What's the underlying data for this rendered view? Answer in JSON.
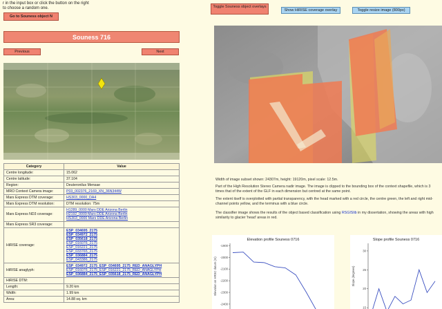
{
  "intro": {
    "line1": "r in the input box or click the button on the right",
    "line2": "to choose a random one."
  },
  "goto_button": "Go to Souness object N",
  "object_title": "Souness 716",
  "nav": {
    "previous": "Previous",
    "next": "Next"
  },
  "top_buttons": {
    "toggle_overlays": "Toggle Souness object overlays",
    "show_hirise": "Show HiRISE coverage overlay",
    "toggle_resize": "Toggle resize image (800px)"
  },
  "table": {
    "header_category": "Category",
    "header_value": "Value",
    "rows": {
      "centre_lon": {
        "k": "Centre longitude:",
        "v": "15.062"
      },
      "centre_lat": {
        "k": "Centre latitude:",
        "v": "37.104"
      },
      "region": {
        "k": "Region:",
        "v": "Deuteronilus Mensae"
      },
      "mro_ctx": {
        "k": "MRO Context Camera image:",
        "v": "P03_002376_2169_XN_36N344W"
      },
      "hirise_dtm_cov": {
        "k": "Mars Express DTM coverage:",
        "v": "HS303_0000_DA4"
      },
      "dtm_res": {
        "k": "Mars Express DTM resolution:",
        "v": "DTM resolution: 75m"
      },
      "nd3": {
        "k": "Mars Express ND3 coverage:",
        "links": [
          "H1289_0000 Mars DDE Arizona Berlin",
          "H2192_0009 Mars DDE Arizona Berlin",
          "HS303_0000 Mars DDE Arizona Berlin"
        ]
      },
      "sr3": {
        "k": "Mars Express SR3 coverage:",
        "v": ""
      },
      "hirise_cov": {
        "k": "HiRISE coverage:",
        "links": [
          "ESP_034695_2175",
          "ESP_034972_2175",
          "ESP_035618_2175",
          "ESP_016076_2175",
          "ESP_016221_2175",
          "ESP_033765_2175",
          "ESP_036884_2175",
          "ESP_043386_2175"
        ]
      },
      "hirise_ana": {
        "k": "HiRISE anaglyph:",
        "links": [
          "ESP_034972_2175_ESP_034695_2175_RED_ANAGLYPH",
          "ESP_016076_2175_ESP_016221_2175_RED_ANAGLYPH",
          "ESP_036884_2175_ESP_035618_2175_RED_ANAGLYPH"
        ]
      },
      "hirise_dtm": {
        "k": "HiRISE DTM:",
        "v": ""
      },
      "length": {
        "k": "Length:",
        "v": "9.20 km"
      },
      "width": {
        "k": "Width:",
        "v": "1.99 km"
      },
      "area": {
        "k": "Area:",
        "v": "14.88 sq. km"
      }
    }
  },
  "image_caption": "Width of image subset shown: 24307m, height: 19120m, pixel scale: 12.5m.",
  "para1": "Part of the High Resolution Stereo Camera nadir image. The image is clipped to the bounding box of the context shapefile, which is 3 times that of the extent of the GLF in each dimension but centred at the same point.",
  "para2": "The extent itself is overplotted with partial transparency, with the head marked with a red circle, the centre green, the left and right mid-channel points yellow, and the terminus with a blue circle.",
  "para3_pre": "The classifier image shows the results of the object based classification using ",
  "para3_link": "RSGISlib",
  "para3_post": " in my dissertation, showing the areas with high similarity to glacier 'head' areas in red.",
  "colors": {
    "accent_red": "#ef8672",
    "accent_blue": "#a9d4f2",
    "link": "#1a35c9",
    "bg": "#fefbe3"
  },
  "chart_data": [
    {
      "type": "line",
      "title": "Elevation profile Souness 0716",
      "ylabel": "Elevation on HRSC datum (m)",
      "xlabel": "",
      "yticks": [
        "-1900",
        "-2000",
        "-2100",
        "-2200",
        "-2300",
        "-2400",
        "-2500"
      ],
      "ylim": [
        -2560,
        -1880
      ],
      "x": [
        0,
        1,
        2,
        3,
        4,
        5,
        6,
        7,
        8,
        9
      ],
      "series": [
        {
          "values": [
            -1960,
            -1955,
            -2040,
            -2045,
            -2080,
            -2090,
            -2150,
            -2300,
            -2460,
            -2560
          ]
        }
      ]
    },
    {
      "type": "line",
      "title": "Slope profile Souness 0716",
      "ylabel": "Slope (degrees)",
      "xlabel": "",
      "yticks": [
        "30",
        "25",
        "20",
        "15"
      ],
      "ylim": [
        11,
        32
      ],
      "x": [
        0,
        1,
        2,
        3,
        4,
        5,
        6,
        7,
        8
      ],
      "series": [
        {
          "values": [
            13,
            20,
            14,
            18,
            16,
            17,
            25,
            19,
            22
          ]
        }
      ]
    }
  ]
}
